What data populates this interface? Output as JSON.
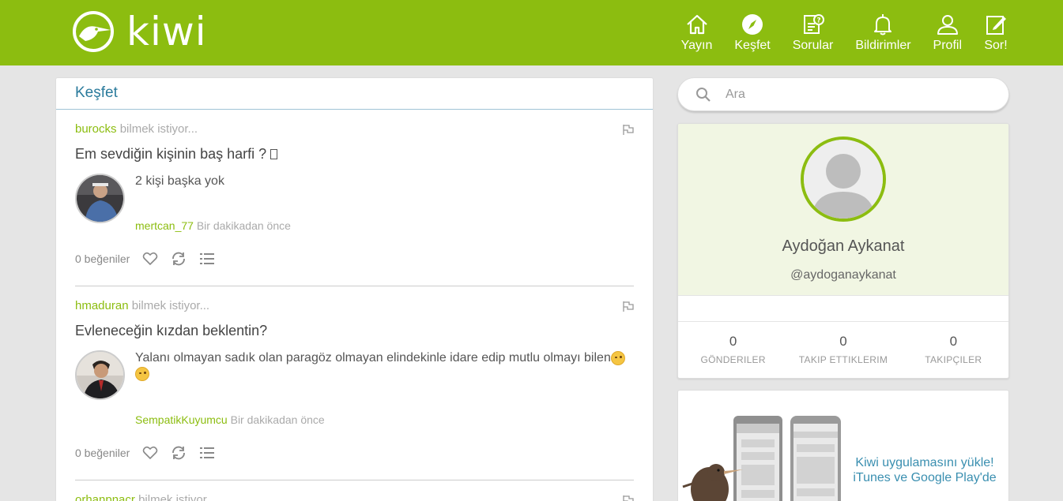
{
  "header": {
    "logo_text": "kiwi",
    "nav": [
      {
        "label": "Yayın",
        "icon": "home-icon"
      },
      {
        "label": "Keşfet",
        "icon": "compass-icon"
      },
      {
        "label": "Sorular",
        "icon": "questions-icon"
      },
      {
        "label": "Bildirimler",
        "icon": "bell-icon"
      },
      {
        "label": "Profil",
        "icon": "user-icon"
      },
      {
        "label": "Sor!",
        "icon": "edit-icon"
      }
    ]
  },
  "feed": {
    "title": "Keşfet",
    "posts": [
      {
        "asker": "burocks",
        "asker_suffix": "bilmek istiyor...",
        "question": "Em sevdiğin kişinin baş harfi ? ",
        "answer": "2 kişi başka yok",
        "answerer": "mertcan_77",
        "time": "Bir dakikadan önce",
        "likes": "0 beğeniler"
      },
      {
        "asker": "hmaduran",
        "asker_suffix": "bilmek istiyor...",
        "question": "Evleneceğin kızdan beklentin?",
        "answer": "Yalanı olmayan sadık olan paragöz olmayan elindekinle idare edip mutlu olmayı bilen",
        "answerer": "SempatikKuyumcu",
        "time": "Bir dakikadan önce",
        "likes": "0 beğeniler"
      },
      {
        "asker": "orhanpnacr",
        "asker_suffix": "bilmek istiyor..."
      }
    ]
  },
  "search": {
    "placeholder": "Ara"
  },
  "profile": {
    "name": "Aydoğan Aykanat",
    "handle": "@aydoganaykanat",
    "stats": [
      {
        "value": "0",
        "label": "GÖNDERILER"
      },
      {
        "value": "0",
        "label": "TAKIP ETTIKLERIM"
      },
      {
        "value": "0",
        "label": "TAKIPÇILER"
      }
    ]
  },
  "app_promo": {
    "line1": "Kiwi uygulamasını yükle!",
    "line2": "iTunes ve Google Play'de"
  },
  "colors": {
    "brand_green": "#8cbd10",
    "link_blue": "#3a8fb0",
    "profile_bg": "#f1f6e3"
  }
}
